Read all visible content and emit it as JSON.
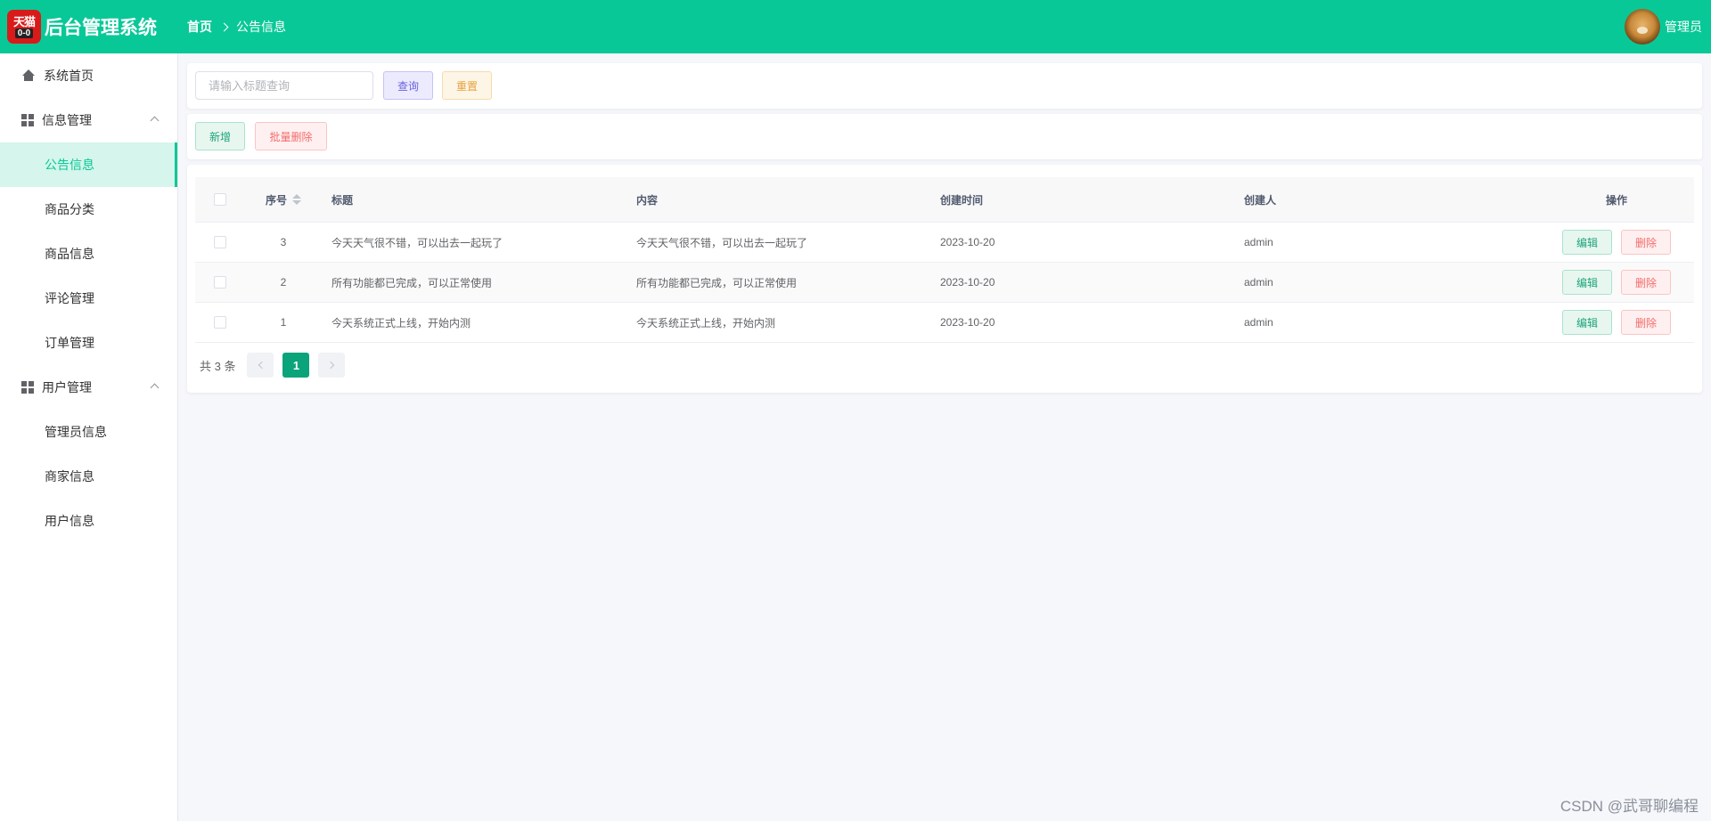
{
  "header": {
    "logo_top": "天猫",
    "logo_bottom": "0-0",
    "app_title": "后台管理系统",
    "breadcrumb": [
      "首页",
      "公告信息"
    ],
    "user_name": "管理员",
    "bg_color": "#09c897"
  },
  "sidebar": {
    "items": [
      {
        "label": "系统首页",
        "icon": "home-icon"
      },
      {
        "label": "信息管理",
        "icon": "grid-icon",
        "expanded": true
      },
      {
        "label": "公告信息",
        "active": true
      },
      {
        "label": "商品分类"
      },
      {
        "label": "商品信息"
      },
      {
        "label": "评论管理"
      },
      {
        "label": "订单管理"
      },
      {
        "label": "用户管理",
        "icon": "grid-icon",
        "expanded": true
      },
      {
        "label": "管理员信息"
      },
      {
        "label": "商家信息"
      },
      {
        "label": "用户信息"
      }
    ]
  },
  "search": {
    "placeholder": "请输入标题查询",
    "value": "",
    "query_label": "查询",
    "reset_label": "重置"
  },
  "ops": {
    "add_label": "新增",
    "bulk_delete_label": "批量删除"
  },
  "table": {
    "headers": {
      "index": "序号",
      "title": "标题",
      "content": "内容",
      "created_at": "创建时间",
      "creator": "创建人",
      "actions": "操作"
    },
    "edit_label": "编辑",
    "delete_label": "删除",
    "rows": [
      {
        "index": "3",
        "title": "今天天气很不错，可以出去一起玩了",
        "content": "今天天气很不错，可以出去一起玩了",
        "created_at": "2023-10-20",
        "creator": "admin"
      },
      {
        "index": "2",
        "title": "所有功能都已完成，可以正常使用",
        "content": "所有功能都已完成，可以正常使用",
        "created_at": "2023-10-20",
        "creator": "admin"
      },
      {
        "index": "1",
        "title": "今天系统正式上线，开始内测",
        "content": "今天系统正式上线，开始内测",
        "created_at": "2023-10-20",
        "creator": "admin"
      }
    ]
  },
  "pagination": {
    "total_text": "共 3 条",
    "current_page": "1"
  },
  "watermark": "CSDN @武哥聊编程"
}
